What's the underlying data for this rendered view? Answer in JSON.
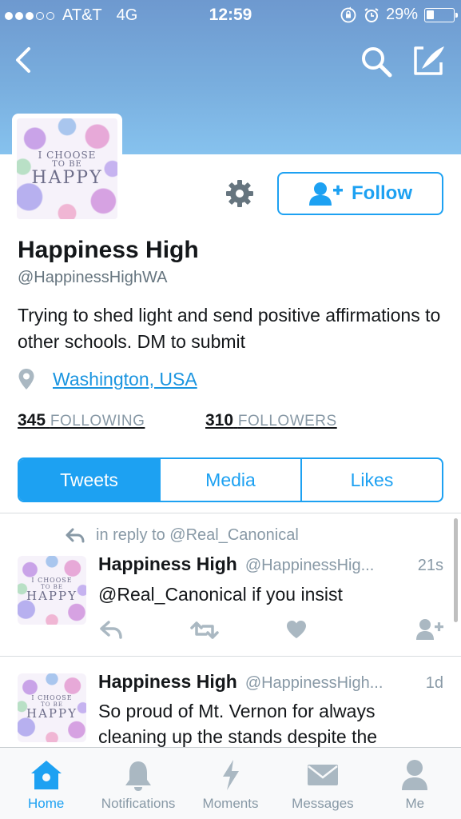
{
  "status_bar": {
    "carrier": "AT&T",
    "network": "4G",
    "time": "12:59",
    "battery": "29%",
    "battery_level": 0.29,
    "signal_bars_filled": 3,
    "signal_bars_total": 5
  },
  "nav": {
    "back_icon": "chevron-left-icon",
    "search_icon": "search-icon",
    "compose_icon": "compose-icon"
  },
  "profile": {
    "avatar_text": [
      "I CHOOSE",
      "TO BE",
      "HAPPY"
    ],
    "name": "Happiness High",
    "handle": "@HappinessHighWA",
    "bio": "Trying to shed light and send positive affirmations to other schools. DM to submit",
    "location": "Washington, USA",
    "following_count": "345",
    "following_label": "FOLLOWING",
    "followers_count": "310",
    "followers_label": "FOLLOWERS",
    "follow_label": "Follow"
  },
  "tabs": [
    {
      "label": "Tweets",
      "active": true
    },
    {
      "label": "Media",
      "active": false
    },
    {
      "label": "Likes",
      "active": false
    }
  ],
  "tweets": [
    {
      "reply_to": "in reply to @Real_Canonical",
      "name": "Happiness High",
      "handle": "@HappinessHig...",
      "time": "21s",
      "text": "@Real_Canonical if you insist"
    },
    {
      "name": "Happiness High",
      "handle": "@HappinessHigh...",
      "time": "1d",
      "text": "So proud of Mt. Vernon for always cleaning up the stands despite the"
    }
  ],
  "bottom_nav": [
    {
      "label": "Home",
      "icon": "home-icon",
      "active": true
    },
    {
      "label": "Notifications",
      "icon": "bell-icon",
      "active": false
    },
    {
      "label": "Moments",
      "icon": "lightning-icon",
      "active": false
    },
    {
      "label": "Messages",
      "icon": "envelope-icon",
      "active": false
    },
    {
      "label": "Me",
      "icon": "person-icon",
      "active": false
    }
  ],
  "colors": {
    "accent": "#1da1f2",
    "header_top": "#6e99cf",
    "header_bottom": "#86c2ee",
    "muted": "#8899a6"
  }
}
